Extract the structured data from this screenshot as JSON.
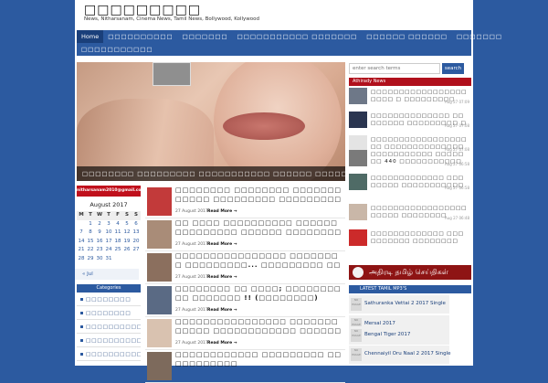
{
  "site": {
    "title": "□□□□□□□□□",
    "tagline": "News, Nitharsanam, Cinema News, Tamil News, Bollywood, Kollywood"
  },
  "nav": {
    "row1": [
      "Home",
      "□□□□□□□□□□",
      "□□□□□□□",
      "□□□□□□□□□□□ □□□□□□□",
      "□□□□□□ □□□□□□",
      "□□□□□□□"
    ],
    "row2": [
      "□□□□□□□□□□□"
    ]
  },
  "slider": {
    "caption": "□□□□□□□□ □□□□□□□□□ □□□□□□□□□□□ □□□□□□ □□□□□□□□!!"
  },
  "search": {
    "placeholder": "enter search terms",
    "button_label": "search"
  },
  "athirady_news": {
    "heading": "Athirady News",
    "items": [
      {
        "title": "□□□□□□□□□□□□□□□□□□□□□ □ □□□□□□□□□",
        "date": "Aug 27 07:09"
      },
      {
        "title": "□□□□□□□□□□□□□□ □□□□□□□□ □□□□□□□□□ □□□□□□□□□□",
        "date": "Aug 27 07:08"
      },
      {
        "title": "□□□□□□□□□□□□□□□□□□□ □□□□□□□□□□□□□□",
        "date": "Aug 27 07:08"
      },
      {
        "title": "□□□□□□□□□□□ □□□□□□□ 440 □□□□□□□□□□□",
        "date": "Aug 27 06:58"
      },
      {
        "title": "□□□□□□□□□□□□□ □□□□□□□□ □□□□□□□□□□□",
        "date": "Aug 27 06:58"
      },
      {
        "title": "□□□□□□□□□□□□□□□□□□□□□□ □□□□□□□□",
        "date": "Aug 27 06:48"
      },
      {
        "title": "□□□□□□□□□□□□□ □□□□□□□□□□ □□□□□□□□",
        "date": ""
      }
    ],
    "banner": "அதிரடி தமிழ் செய்திகள்"
  },
  "mp3": {
    "heading": "LATEST TAMIL MP3'S",
    "items": [
      {
        "title": "Sathuranka Vettai 2 2017 Single"
      },
      {
        "title": "Mersal 2017"
      },
      {
        "title": "Bengal Tiger 2017"
      },
      {
        "title": "Chennaiyil Oru Naal 2 2017 Single"
      }
    ],
    "thumb_label": "NO IMAGE"
  },
  "email_box": {
    "label": "nitharsanam2010@gmail.com"
  },
  "calendar": {
    "caption": "August 2017",
    "headers": [
      "M",
      "T",
      "W",
      "T",
      "F",
      "S",
      "S"
    ],
    "weeks": [
      [
        "",
        "1",
        "2",
        "3",
        "4",
        "5",
        "6"
      ],
      [
        "7",
        "8",
        "9",
        "10",
        "11",
        "12",
        "13"
      ],
      [
        "14",
        "15",
        "16",
        "17",
        "18",
        "19",
        "20"
      ],
      [
        "21",
        "22",
        "23",
        "24",
        "25",
        "26",
        "27"
      ],
      [
        "28",
        "29",
        "30",
        "31",
        "",
        "",
        ""
      ]
    ],
    "prev_link": "« Jul"
  },
  "categories": {
    "heading": "Categories",
    "items": [
      "□□□□□□□□",
      "□□□□□□□□",
      "□□□□□□□□□□",
      "□□□□□□□□□□□",
      "□□□□□□□□□□"
    ]
  },
  "posts": [
    {
      "title": "□□□□□□□□ □□□□□□□□ □□□□□□□□□□□□ □□□□□□□□□ □□□□□□□□□□□□□?..!!",
      "date": "27 August 2017",
      "read_more": "Read More"
    },
    {
      "title": "□□ □□□□ □□□□□□□□□□ □□□□□□□□□□□□□□□ □□□□□□ □□□□□□□□□ □□□□□□□□!!",
      "date": "27 August 2017",
      "read_more": "Read More"
    },
    {
      "title": "□□□□□□□□□□□□□□□□ □□□□□□□□ □□□□□□□□□... □□□□□□□□□ □□□□□□□□□!!",
      "date": "27 August 2017",
      "read_more": "Read More"
    },
    {
      "title": "□□□□□□□□ □□ □□□□; □□□□□□□□ □□ □□□□□□□ !! (□□□□□□□□)",
      "date": "27 August 2017",
      "read_more": "Read More"
    },
    {
      "title": "□□□□□□□□□□□□□□□□ □□□□□□□□□□□□ □□□□□□□□□□□□ □□□□□□□□!!",
      "date": "27 August 2017",
      "read_more": "Read More"
    },
    {
      "title": "□□□□□□□□□□□□ □□□□□□□□□ □□□□□□□□□□□",
      "date": "",
      "read_more": ""
    }
  ],
  "colors": {
    "background": "#2c5aa0",
    "nav": "#2c5aa0",
    "accent_red": "#b0101c"
  }
}
